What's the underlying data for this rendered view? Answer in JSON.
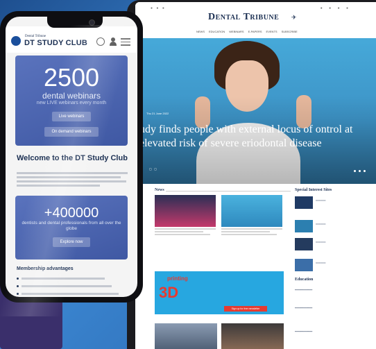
{
  "tablet": {
    "logo": "Dental Tribune",
    "nav": [
      "News",
      "Education",
      "Webinars",
      "E-papers",
      "Events",
      "Subscribe"
    ],
    "hero": {
      "date": "Thu 21 June 2022",
      "title": "udy finds people with external locus of ontrol at elevated risk of severe eriodontal disease"
    },
    "sections": {
      "news": "News",
      "special_interest": "Special Interest Sites",
      "education": "Education"
    },
    "banner": {
      "small": "printing",
      "big": "3D",
      "button": "Sign up for free newsletter"
    }
  },
  "phone": {
    "logo_top": "Dental Tribune",
    "logo_main": "DT STUDY CLUB",
    "card1": {
      "number": "2500",
      "line1": "dental webinars",
      "line2": "new LIVE webinars every month",
      "button1": "Live webinars",
      "button2": "On demand webinars"
    },
    "welcome": "Welcome to the DT Study Club",
    "card2": {
      "number": "+400000",
      "line1": "dentists and dental professionals from all over the globe",
      "button": "Explore now"
    },
    "membership_title": "Membership advantages"
  },
  "colors": {
    "brand_navy": "#1b2f52",
    "card_blue": "#4c66b0",
    "accent_red": "#e73a30",
    "banner_blue": "#27a7e0"
  }
}
